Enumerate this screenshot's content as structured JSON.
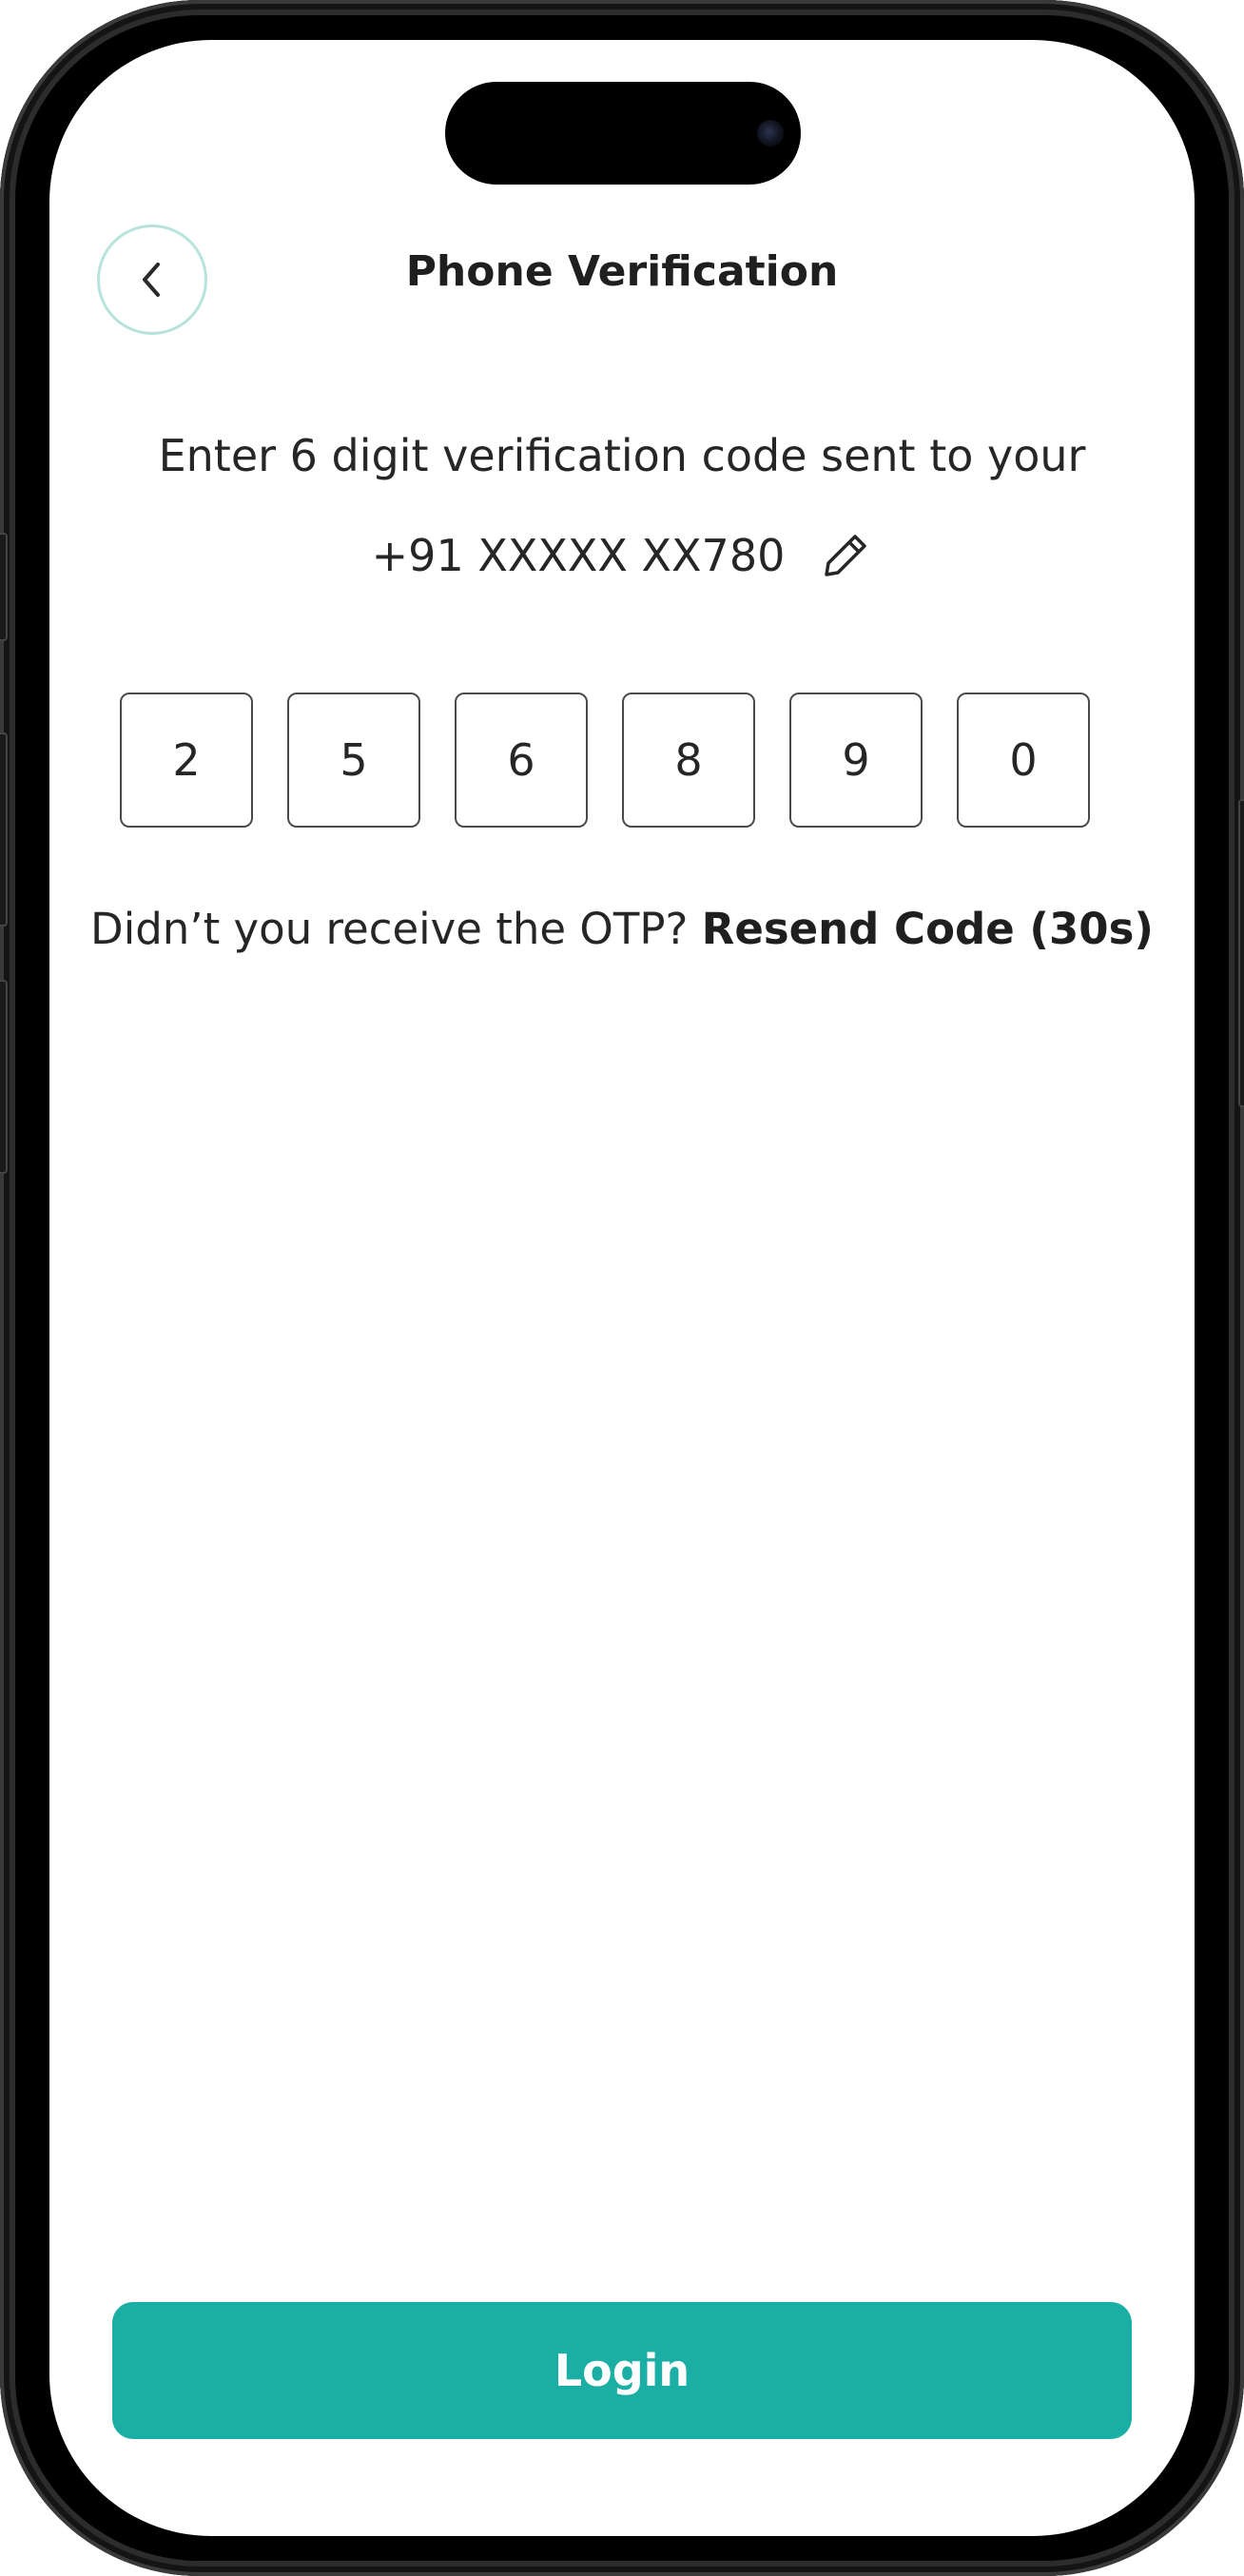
{
  "header": {
    "title": "Phone Verification",
    "back_icon": "chevron-left-icon"
  },
  "verification": {
    "instruction": "Enter 6 digit verification code sent to your",
    "phone_number": "+91 XXXXX XX780",
    "edit_icon": "pencil-icon"
  },
  "otp": {
    "digits": [
      "2",
      "5",
      "6",
      "8",
      "9",
      "0"
    ]
  },
  "resend": {
    "prompt": "Didn’t you receive the OTP?",
    "link_label": "Resend Code (30s)"
  },
  "actions": {
    "login_label": "Login"
  },
  "colors": {
    "accent": "#1aaea4",
    "back_border": "#b8e3dc",
    "text": "#262626"
  }
}
